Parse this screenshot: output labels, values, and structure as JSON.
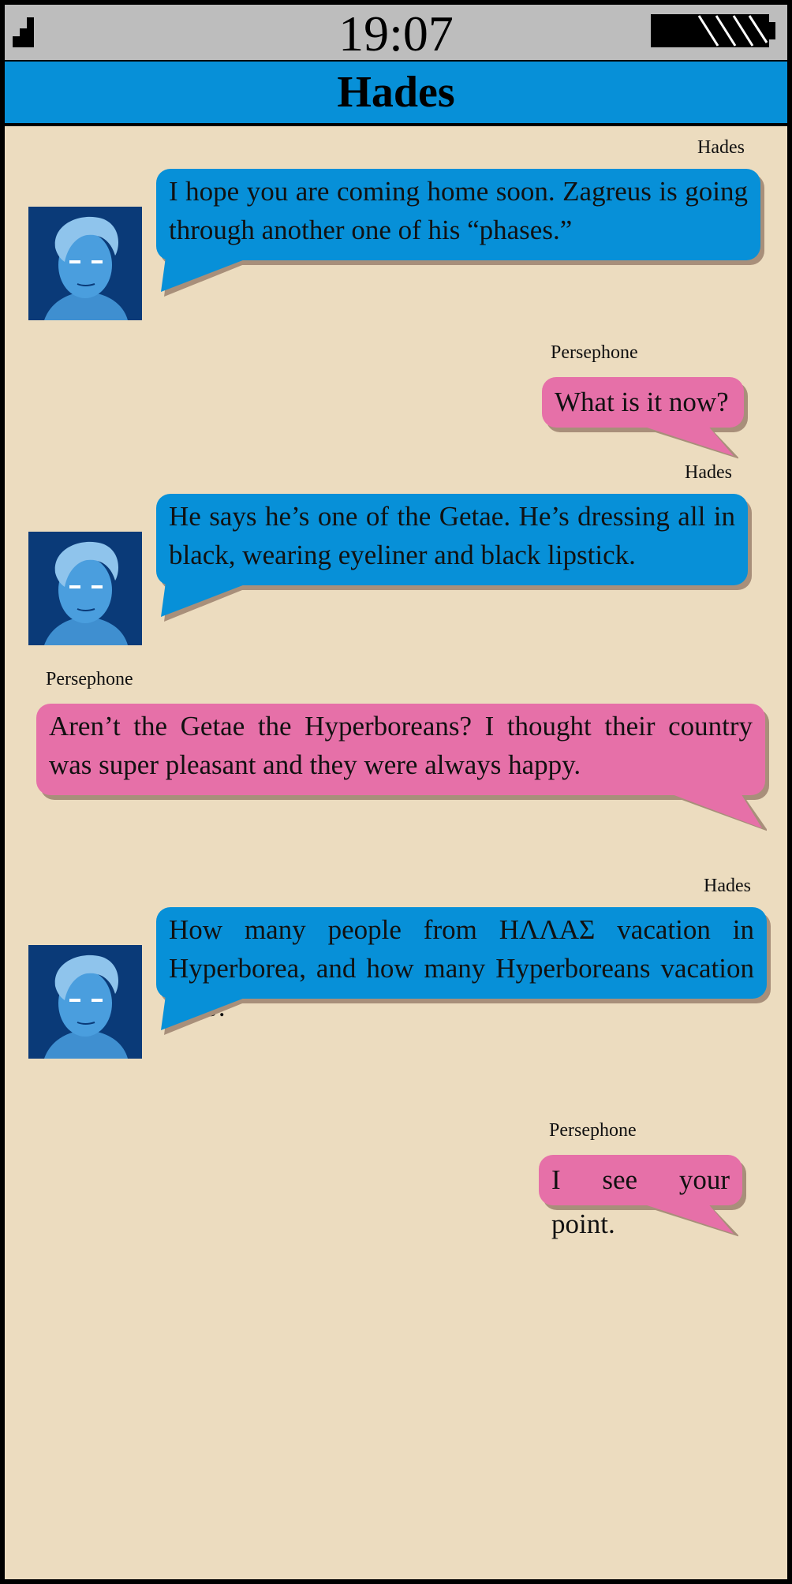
{
  "status_bar": {
    "time": "19:07",
    "signal_icon": "signal-bars-icon",
    "battery_icon": "battery-icon"
  },
  "header": {
    "title": "Hades"
  },
  "colors": {
    "hades_bubble": "#0790d8",
    "persephone_bubble": "#e670a8",
    "background": "#ecdcbf",
    "status_bar": "#bdbdbd"
  },
  "messages": [
    {
      "sender": "Hades",
      "text": "I hope you are coming home soon. Zagreus is going through another one of his “phases.”"
    },
    {
      "sender": "Persephone",
      "text": "What is it now?"
    },
    {
      "sender": "Hades",
      "text": "He says he’s one of the Getae. He’s dressing all in black, wearing eyeliner and black lipstick."
    },
    {
      "sender": "Persephone",
      "text": "Aren’t the Getae the Hyperboreans? I thought their country was super pleasant and they were always happy."
    },
    {
      "sender": "Hades",
      "text": "How many people from ΗΛΛΑΣ vacation in Hyperborea, and how many Hyperboreans vacation here?"
    },
    {
      "sender": "Persephone",
      "text": "I see your point."
    }
  ]
}
